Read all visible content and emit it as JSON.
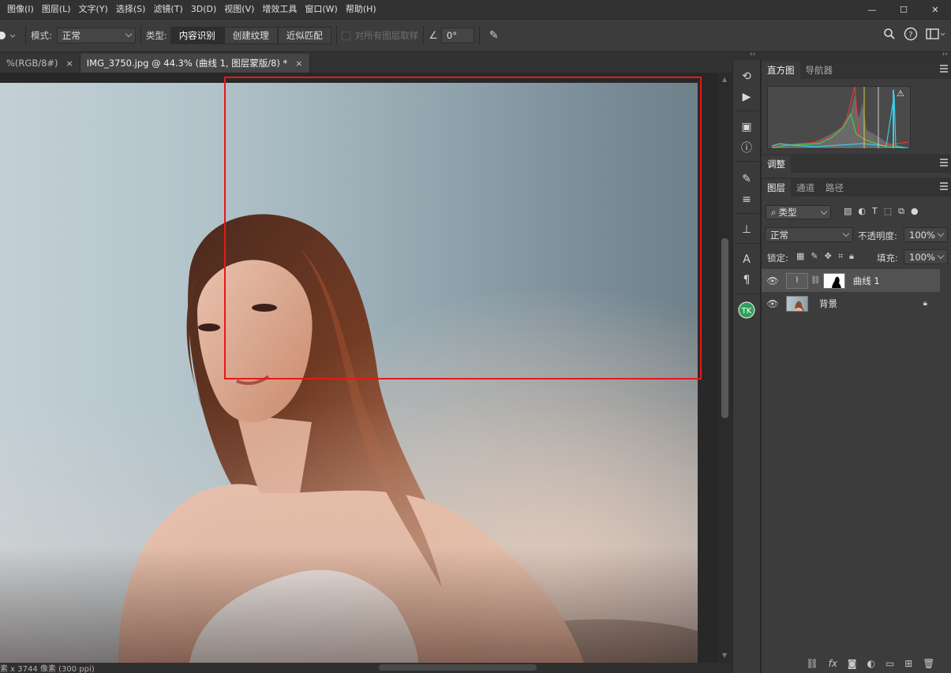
{
  "menu": [
    "图像(I)",
    "图层(L)",
    "文字(Y)",
    "选择(S)",
    "滤镜(T)",
    "3D(D)",
    "视图(V)",
    "增效工具",
    "窗口(W)",
    "帮助(H)"
  ],
  "window_controls": {
    "minimize": "—",
    "maximize": "☐",
    "close": "✕"
  },
  "options": {
    "mode_label": "模式:",
    "mode_value": "正常",
    "type_label": "类型:",
    "type_buttons": [
      "内容识别",
      "创建纹理",
      "近似匹配"
    ],
    "sample_all_label": "对所有图层取样",
    "angle_value": "0°"
  },
  "tabs": [
    {
      "label": "%(RGB/8#)",
      "close": "×"
    },
    {
      "label": "IMG_3750.jpg @ 44.3% (曲线 1, 图层蒙版/8) *",
      "close": "×"
    }
  ],
  "status": "素 x 3744 像素 (300 ppi)",
  "right_panel": {
    "top_tabs": [
      "直方图",
      "导航器"
    ],
    "adjust_tab": "调整",
    "layer_tabs": [
      "图层",
      "通道",
      "路径"
    ],
    "filter_label": "类型",
    "blend_mode": "正常",
    "opacity_label": "不透明度:",
    "opacity_value": "100%",
    "lock_label": "锁定:",
    "fill_label": "填充:",
    "fill_value": "100%",
    "layers": [
      {
        "name": "曲线 1",
        "selected": true
      },
      {
        "name": "背景",
        "selected": false
      }
    ]
  },
  "colors": {
    "selection": "#e81818",
    "panel_bg": "#3c3c3c",
    "canvas_bg": "#282828"
  }
}
